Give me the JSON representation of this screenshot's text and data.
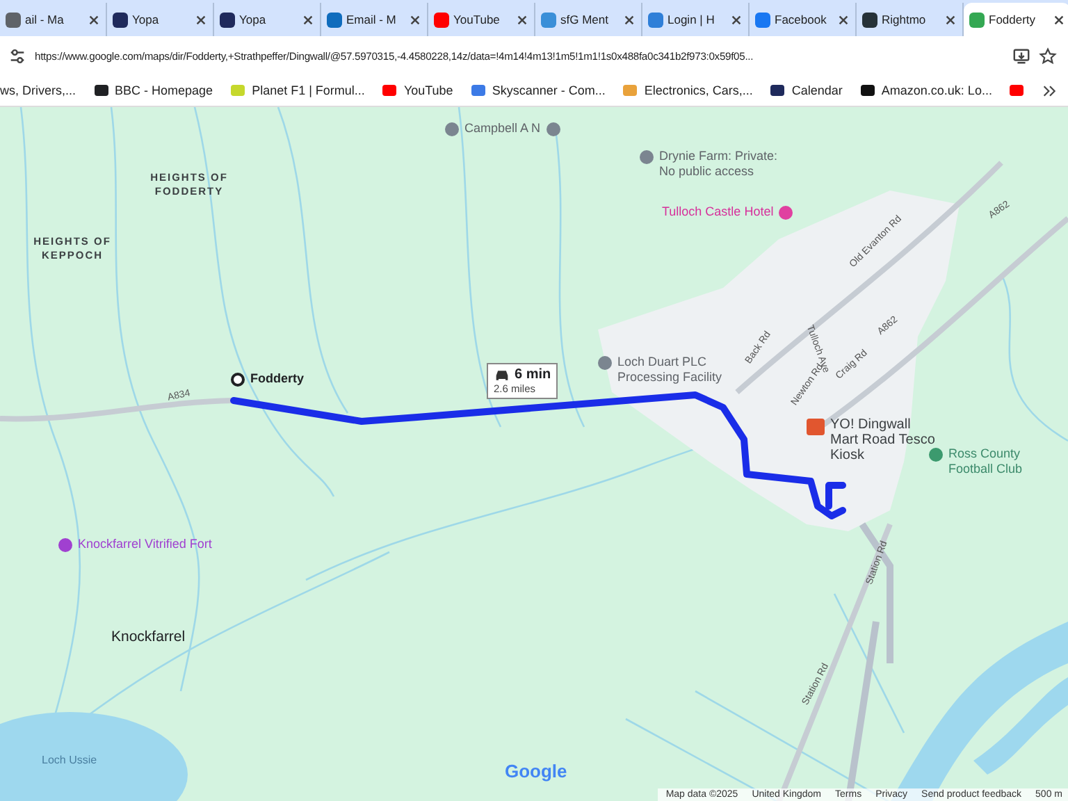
{
  "tabs": [
    {
      "label": "ail - Ma",
      "color": "#5f6368",
      "selected": false
    },
    {
      "label": "Yopa",
      "color": "#1f2a5c",
      "selected": false
    },
    {
      "label": "Yopa",
      "color": "#1f2a5c",
      "selected": false
    },
    {
      "label": "Email - M",
      "color": "#0f6cbd",
      "selected": false
    },
    {
      "label": "YouTube",
      "color": "#ff0000",
      "selected": false
    },
    {
      "label": "sfG Ment",
      "color": "#3a8fd8",
      "selected": false
    },
    {
      "label": "Login | H",
      "color": "#2f7fd8",
      "selected": false
    },
    {
      "label": "Facebook",
      "color": "#1877f2",
      "selected": false
    },
    {
      "label": "Rightmo",
      "color": "#263238",
      "selected": false
    },
    {
      "label": "Fodderty",
      "color": "#34a853",
      "selected": true
    }
  ],
  "address_bar": {
    "url": "https://www.google.com/maps/dir/Fodderty,+Strathpeffer/Dingwall/@57.5970315,-4.4580228,14z/data=!4m14!4m13!1m5!1m1!1s0x488fa0c341b2f973:0x59f05..."
  },
  "bookmarks": [
    {
      "label": "ws, Drivers,..."
    },
    {
      "label": "BBC - Homepage",
      "color": "#202124"
    },
    {
      "label": "Planet F1 | Formul...",
      "color": "#c6d82c"
    },
    {
      "label": "YouTube",
      "color": "#ff0000"
    },
    {
      "label": "Skyscanner - Com...",
      "color": "#3c7ae6"
    },
    {
      "label": "Electronics, Cars,...",
      "color": "#e9a23b"
    },
    {
      "label": "Calendar",
      "color": "#1f2a5c"
    },
    {
      "label": "Amazon.co.uk: Lo...",
      "color": "#111111"
    },
    {
      "color": "#ff0000"
    }
  ],
  "map": {
    "labels": [
      {
        "text": "Campbell A N",
        "kind": "poi"
      },
      {
        "text": "HEIGHTS OF FODDERTY",
        "kind": "area"
      },
      {
        "text": "HEIGHTS OF KEPPOCH",
        "kind": "area"
      },
      {
        "text": "Drynie Farm: Private: No public access",
        "kind": "poi"
      },
      {
        "text": "Tulloch Castle Hotel",
        "kind": "hotel"
      },
      {
        "text": "Fodderty",
        "kind": "origin"
      },
      {
        "text": "Loch Duart PLC Processing Facility",
        "kind": "poi"
      },
      {
        "text": "YO! Dingwall Mart Road Tesco Kiosk",
        "kind": "shop"
      },
      {
        "text": "Ross County Football Club",
        "kind": "sport"
      },
      {
        "text": "Knockfarrel Vitrified Fort",
        "kind": "landmark"
      },
      {
        "text": "Knockfarrel",
        "kind": "town"
      },
      {
        "text": "Loch Ussie",
        "kind": "water"
      }
    ],
    "roads": [
      "A834",
      "Back Rd",
      "Tulloch Ave",
      "Old Evanton Rd",
      "Craig Rd",
      "A862",
      "A862",
      "Newton Rd",
      "Station Rd",
      "Station Rd"
    ],
    "route": {
      "time": "6 min",
      "distance": "2.6 miles"
    },
    "logo": "Google",
    "attribution": [
      "Map data ©2025",
      "United Kingdom",
      "Terms",
      "Privacy",
      "Send product feedback",
      "500 m"
    ]
  }
}
